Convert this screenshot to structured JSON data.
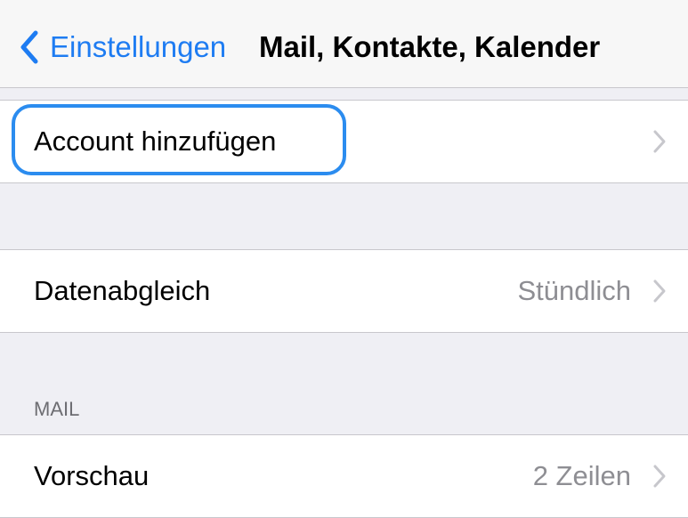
{
  "nav": {
    "back_label": "Einstellungen",
    "title": "Mail, Kontakte, Kalender"
  },
  "rows": {
    "add_account": {
      "label": "Account hinzufügen"
    },
    "fetch": {
      "label": "Datenabgleich",
      "value": "Stündlich"
    },
    "preview": {
      "label": "Vorschau",
      "value": "2 Zeilen"
    }
  },
  "sections": {
    "mail_header": "MAIL"
  },
  "colors": {
    "accent": "#1e7cf2",
    "highlight": "#2b8cef",
    "background": "#efeff4",
    "secondary_text": "#8e8e93"
  }
}
